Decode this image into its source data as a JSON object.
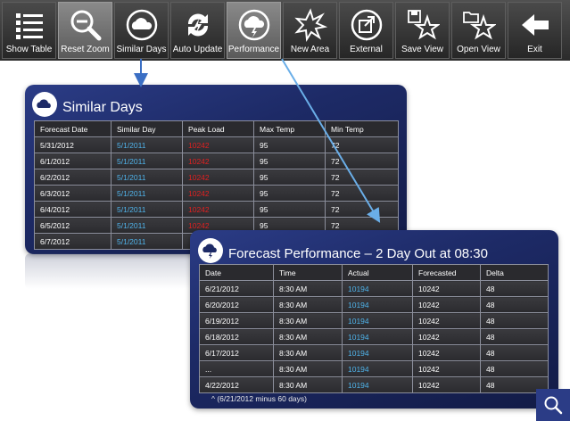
{
  "toolbar": {
    "buttons": [
      {
        "label": "Show Table",
        "icon": "list-icon"
      },
      {
        "label": "Reset Zoom",
        "icon": "zoom-out-icon"
      },
      {
        "label": "Similar Days",
        "icon": "cloud-icon"
      },
      {
        "label": "Auto Update",
        "icon": "lightning-icon"
      },
      {
        "label": "Performance",
        "icon": "storm-cloud-icon"
      },
      {
        "label": "New Area",
        "icon": "starburst-icon"
      },
      {
        "label": "External",
        "icon": "external-link-icon"
      },
      {
        "label": "Save View",
        "icon": "save-star-icon"
      },
      {
        "label": "Open View",
        "icon": "open-star-icon"
      },
      {
        "label": "Exit",
        "icon": "arrow-left-icon"
      }
    ]
  },
  "similar_days": {
    "title": "Similar Days",
    "columns": [
      "Forecast Date",
      "Similar Day",
      "Peak Load",
      "Max Temp",
      "Min Temp"
    ],
    "rows": [
      [
        "5/31/2012",
        "5/1/2011",
        "10242",
        "95",
        "72"
      ],
      [
        "6/1/2012",
        "5/1/2011",
        "10242",
        "95",
        "72"
      ],
      [
        "6/2/2012",
        "5/1/2011",
        "10242",
        "95",
        "72"
      ],
      [
        "6/3/2012",
        "5/1/2011",
        "10242",
        "95",
        "72"
      ],
      [
        "6/4/2012",
        "5/1/2011",
        "10242",
        "95",
        "72"
      ],
      [
        "6/5/2012",
        "5/1/2011",
        "10242",
        "95",
        "72"
      ],
      [
        "6/7/2012",
        "5/1/2011",
        "",
        "",
        ""
      ]
    ]
  },
  "performance": {
    "title": "Forecast Performance – 2 Day Out at 08:30",
    "columns": [
      "Date",
      "Time",
      "Actual",
      "Forecasted",
      "Delta"
    ],
    "rows": [
      [
        "6/21/2012",
        "8:30 AM",
        "10194",
        "10242",
        "48"
      ],
      [
        "6/20/2012",
        "8:30 AM",
        "10194",
        "10242",
        "48"
      ],
      [
        "6/19/2012",
        "8:30 AM",
        "10194",
        "10242",
        "48"
      ],
      [
        "6/18/2012",
        "8:30 AM",
        "10194",
        "10242",
        "48"
      ],
      [
        "6/17/2012",
        "8:30 AM",
        "10194",
        "10242",
        "48"
      ],
      [
        "...",
        "8:30 AM",
        "10194",
        "10242",
        "48"
      ],
      [
        "4/22/2012",
        "8:30 AM",
        "10194",
        "10242",
        "48"
      ]
    ],
    "footnote": "^ (6/21/2012 minus 60 days)"
  },
  "colors": {
    "panel": "#1d2a66",
    "link": "#4fb3ea",
    "peak_load": "#e02020",
    "arrow": "#6aaee8"
  }
}
